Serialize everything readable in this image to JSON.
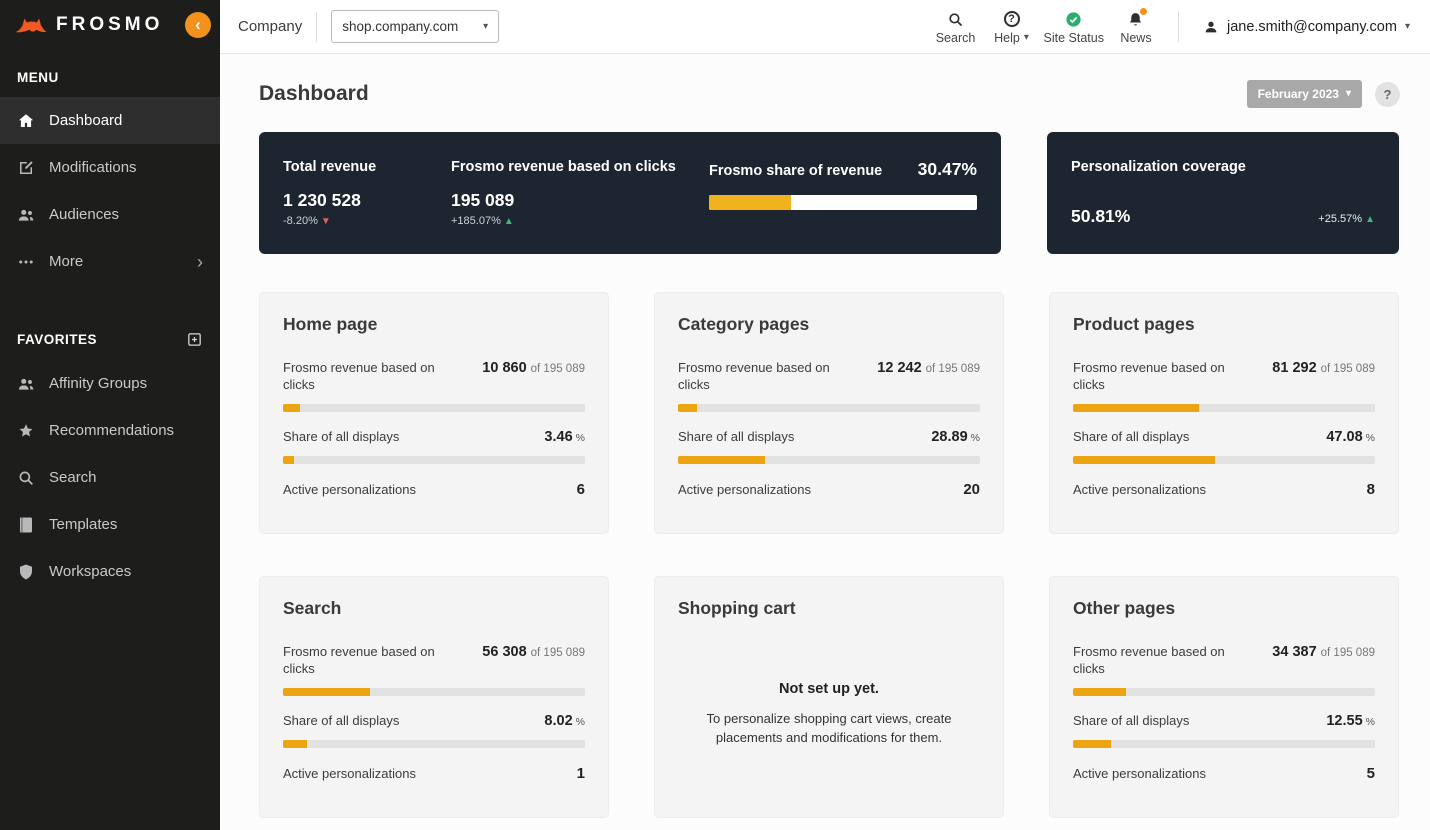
{
  "icons": {
    "chevron_down": "▾",
    "chevron_right": "›",
    "chevron_left": "‹",
    "question": "?"
  },
  "brand": {
    "logo_text": "FROSMO"
  },
  "sidebar": {
    "menu_heading": "MENU",
    "menu": [
      {
        "label": "Dashboard"
      },
      {
        "label": "Modifications"
      },
      {
        "label": "Audiences"
      },
      {
        "label": "More"
      }
    ],
    "favorites_heading": "FAVORITES",
    "favorites": [
      {
        "label": "Affinity Groups"
      },
      {
        "label": "Recommendations"
      },
      {
        "label": "Search"
      },
      {
        "label": "Templates"
      },
      {
        "label": "Workspaces"
      }
    ]
  },
  "topbar": {
    "company_label": "Company",
    "site": "shop.company.com",
    "search_label": "Search",
    "help_label": "Help",
    "site_status_label": "Site Status",
    "news_label": "News",
    "user_email": "jane.smith@company.com"
  },
  "page": {
    "title": "Dashboard",
    "period": "February 2023"
  },
  "summary": {
    "total_revenue": {
      "label": "Total revenue",
      "value": "1 230 528",
      "delta": "-8.20%"
    },
    "frosmo_revenue": {
      "label": "Frosmo revenue based on clicks",
      "value": "195 089",
      "delta": "+185.07%"
    },
    "share_of_revenue": {
      "label": "Frosmo share of revenue",
      "value": "30.47%",
      "percent": 30.47
    },
    "coverage": {
      "label": "Personalization coverage",
      "value": "50.81%",
      "delta": "+25.57%"
    }
  },
  "cards": {
    "labels": {
      "revenue": "Frosmo revenue based on clicks",
      "of_total": "of  195 089",
      "share": "Share of all displays",
      "active": "Active personalizations",
      "percent_sign": "%"
    },
    "items": [
      {
        "title": "Home page",
        "revenue": "10 860",
        "revenue_pct": 5.6,
        "share": "3.46",
        "share_pct": 3.5,
        "active": "6"
      },
      {
        "title": "Category pages",
        "revenue": "12 242",
        "revenue_pct": 6.3,
        "share": "28.89",
        "share_pct": 28.9,
        "active": "20"
      },
      {
        "title": "Product pages",
        "revenue": "81 292",
        "revenue_pct": 41.7,
        "share": "47.08",
        "share_pct": 47.1,
        "active": "8"
      },
      {
        "title": "Search",
        "revenue": "56 308",
        "revenue_pct": 28.9,
        "share": "8.02",
        "share_pct": 8.0,
        "active": "1"
      },
      {
        "title": "Shopping cart",
        "empty_title": "Not set up yet.",
        "empty_text": "To personalize shopping cart views, create placements and modifications for them."
      },
      {
        "title": "Other pages",
        "revenue": "34 387",
        "revenue_pct": 17.6,
        "share": "12.55",
        "share_pct": 12.6,
        "active": "5"
      }
    ]
  }
}
